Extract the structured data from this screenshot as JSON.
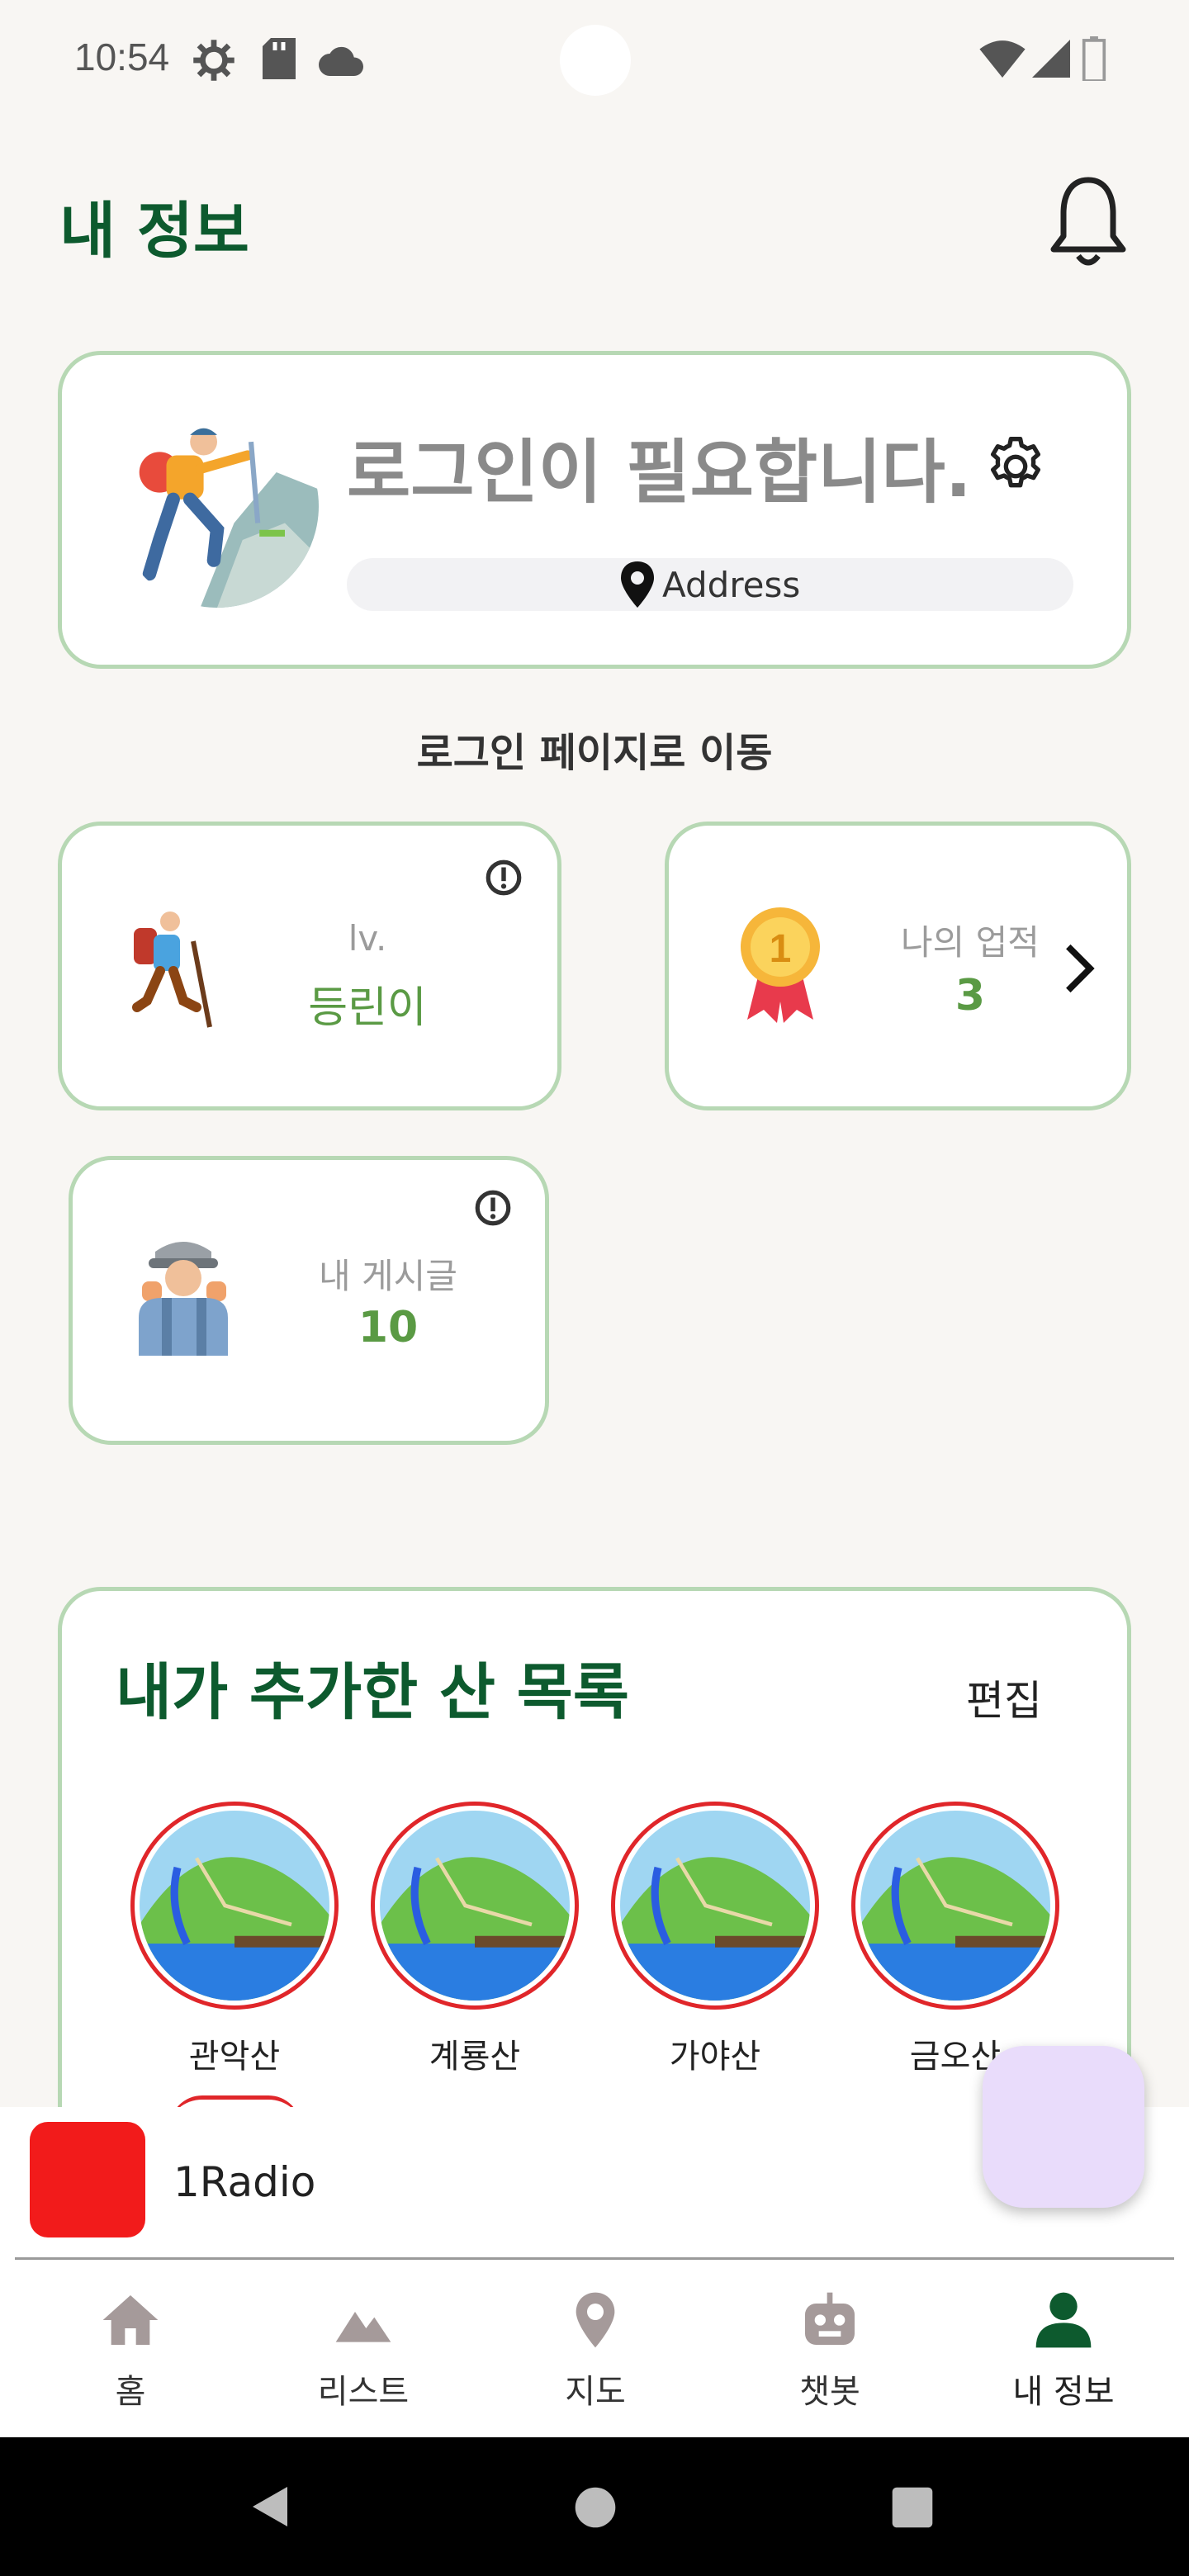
{
  "status_bar": {
    "time": "10:54"
  },
  "header": {
    "title": "내 정보"
  },
  "profile": {
    "status_text": "로그인이 필요합니다.",
    "address": "Address"
  },
  "login_link": "로그인 페이지로 이동",
  "stats": {
    "level": {
      "label": "lv.",
      "value": "등린이"
    },
    "achievements": {
      "label": "나의 업적",
      "value": "3"
    },
    "posts": {
      "label": "내 게시글",
      "value": "10"
    }
  },
  "mountains": {
    "title": "내가 추가한 산 목록",
    "edit_label": "편집",
    "items": [
      "관악산",
      "계룡산",
      "가야산",
      "금오산"
    ]
  },
  "player": {
    "title": "1Radio"
  },
  "bottom_nav": {
    "items": [
      "홈",
      "리스트",
      "지도",
      "챗봇",
      "내 정보"
    ],
    "active_color": "#0d5a2e",
    "inactive_color": "#a59a9a"
  }
}
